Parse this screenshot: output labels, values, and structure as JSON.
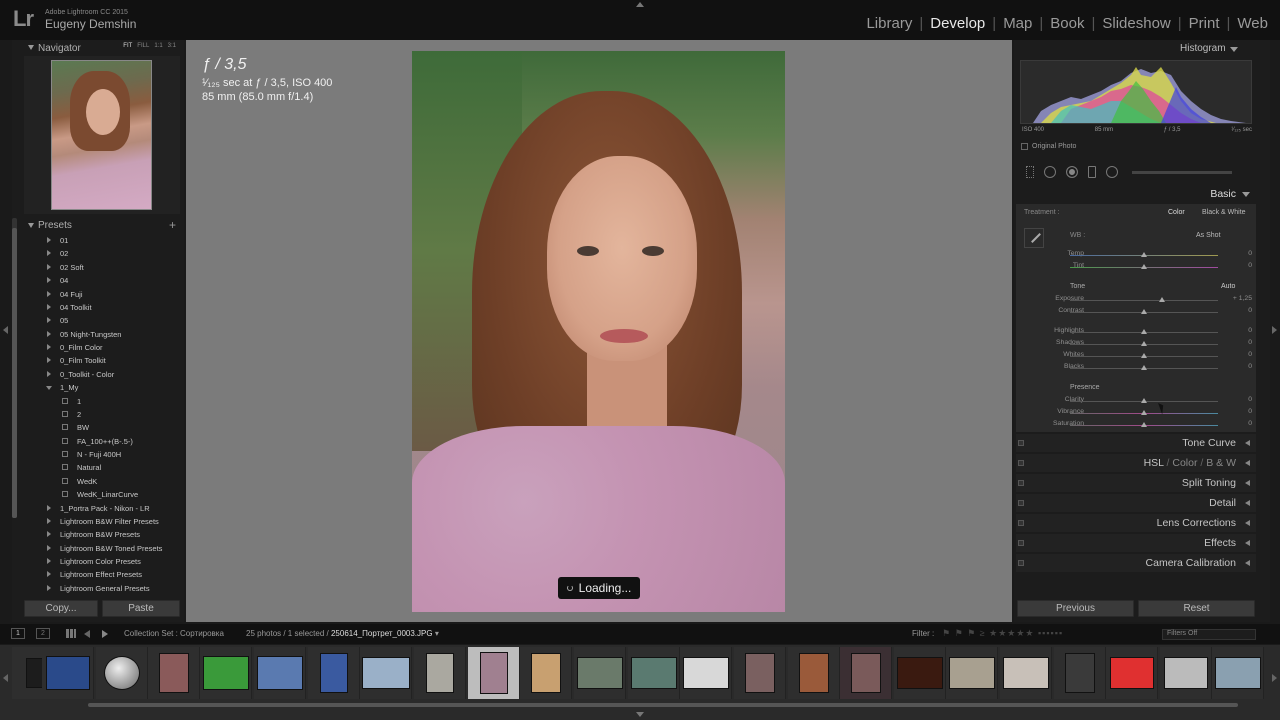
{
  "app": {
    "logo": "Lr",
    "name": "Adobe Lightroom CC 2015",
    "user": "Eugeny Demshin"
  },
  "modules": [
    "Library",
    "Develop",
    "Map",
    "Book",
    "Slideshow",
    "Print",
    "Web"
  ],
  "active_module": "Develop",
  "navigator": {
    "title": "Navigator",
    "options": [
      "FIT",
      "FILL",
      "1:1",
      "3:1"
    ]
  },
  "presets": {
    "title": "Presets",
    "items": [
      {
        "label": "01",
        "level": 0,
        "open": false
      },
      {
        "label": "02",
        "level": 0,
        "open": false
      },
      {
        "label": "02 Soft",
        "level": 0,
        "open": false
      },
      {
        "label": "04",
        "level": 0,
        "open": false
      },
      {
        "label": "04 Fuji",
        "level": 0,
        "open": false
      },
      {
        "label": "04 Toolkit",
        "level": 0,
        "open": false
      },
      {
        "label": "05",
        "level": 0,
        "open": false
      },
      {
        "label": "05 Night-Tungsten",
        "level": 0,
        "open": false
      },
      {
        "label": "0_Film Color",
        "level": 0,
        "open": false
      },
      {
        "label": "0_Film Toolkit",
        "level": 0,
        "open": false
      },
      {
        "label": "0_Toolkit - Color",
        "level": 0,
        "open": false
      },
      {
        "label": "1_My",
        "level": 0,
        "open": true
      },
      {
        "label": "1",
        "level": 1
      },
      {
        "label": "2",
        "level": 1
      },
      {
        "label": "BW",
        "level": 1
      },
      {
        "label": "FA_100++(B-.5-)",
        "level": 1
      },
      {
        "label": "N - Fuji 400H",
        "level": 1
      },
      {
        "label": "Natural",
        "level": 1
      },
      {
        "label": "WedK",
        "level": 1
      },
      {
        "label": "WedK_LinarCurve",
        "level": 1
      },
      {
        "label": "1_Portra Pack - Nikon - LR",
        "level": 0,
        "open": false
      },
      {
        "label": "Lightroom B&W Filter Presets",
        "level": 0,
        "open": false
      },
      {
        "label": "Lightroom B&W Presets",
        "level": 0,
        "open": false
      },
      {
        "label": "Lightroom B&W Toned Presets",
        "level": 0,
        "open": false
      },
      {
        "label": "Lightroom Color Presets",
        "level": 0,
        "open": false
      },
      {
        "label": "Lightroom Effect Presets",
        "level": 0,
        "open": false
      },
      {
        "label": "Lightroom General Presets",
        "level": 0,
        "open": false
      }
    ]
  },
  "left_buttons": {
    "copy": "Copy...",
    "paste": "Paste"
  },
  "info_overlay": {
    "aperture": "ƒ / 3,5",
    "exposure_line": "¹⁄₁₂₅ sec at ƒ / 3,5, ISO 400",
    "lens_line": "85 mm (85.0 mm f/1.4)"
  },
  "loading_text": "Loading...",
  "histogram": {
    "title": "Histogram",
    "meta": [
      "ISO 400",
      "85 mm",
      "ƒ / 3,5",
      "¹⁄₁₂₅ sec"
    ],
    "original_photo": "Original Photo"
  },
  "basic": {
    "title": "Basic",
    "treatment_label": "Treatment :",
    "treatment_color": "Color",
    "treatment_bw": "Black & White",
    "wb_label": "WB :",
    "wb_value": "As Shot",
    "tone_label": "Tone",
    "auto_label": "Auto",
    "presence_label": "Presence",
    "sliders": [
      {
        "label": "Temp",
        "value": "0",
        "pos": 0.5,
        "group": "wb"
      },
      {
        "label": "Tint",
        "value": "0",
        "pos": 0.5,
        "group": "wb"
      },
      {
        "label": "Exposure",
        "value": "+ 1,25",
        "pos": 0.62,
        "group": "tone"
      },
      {
        "label": "Contrast",
        "value": "0",
        "pos": 0.5,
        "group": "tone"
      },
      {
        "label": "Highlights",
        "value": "0",
        "pos": 0.5,
        "group": "tone2"
      },
      {
        "label": "Shadows",
        "value": "0",
        "pos": 0.5,
        "group": "tone2"
      },
      {
        "label": "Whites",
        "value": "0",
        "pos": 0.5,
        "group": "tone2"
      },
      {
        "label": "Blacks",
        "value": "0",
        "pos": 0.5,
        "group": "tone2"
      },
      {
        "label": "Clarity",
        "value": "0",
        "pos": 0.5,
        "group": "presence"
      },
      {
        "label": "Vibrance",
        "value": "0",
        "pos": 0.5,
        "group": "presence"
      },
      {
        "label": "Saturation",
        "value": "0",
        "pos": 0.5,
        "group": "presence"
      }
    ]
  },
  "sections": {
    "tone_curve": "Tone Curve",
    "hsl": "HSL",
    "hsl_sep1": "/",
    "color": "Color",
    "hsl_sep2": "/",
    "bw": "B & W",
    "split_toning": "Split Toning",
    "detail": "Detail",
    "lens_corrections": "Lens Corrections",
    "effects": "Effects",
    "camera_calibration": "Camera Calibration"
  },
  "right_buttons": {
    "previous": "Previous",
    "reset": "Reset"
  },
  "filmstrip_bar": {
    "screen1": "1",
    "screen2": "2",
    "collection": "Collection Set : Сортировка",
    "count": "25 photos / 1 selected /",
    "file": "250614_Портрет_0003.JPG",
    "filter_label": "Filter :",
    "filters_off": "Filters Off"
  },
  "colors": {
    "background": "#7b7b7b",
    "panel": "#1c1c1c",
    "active_module": "#e8e8e8"
  }
}
